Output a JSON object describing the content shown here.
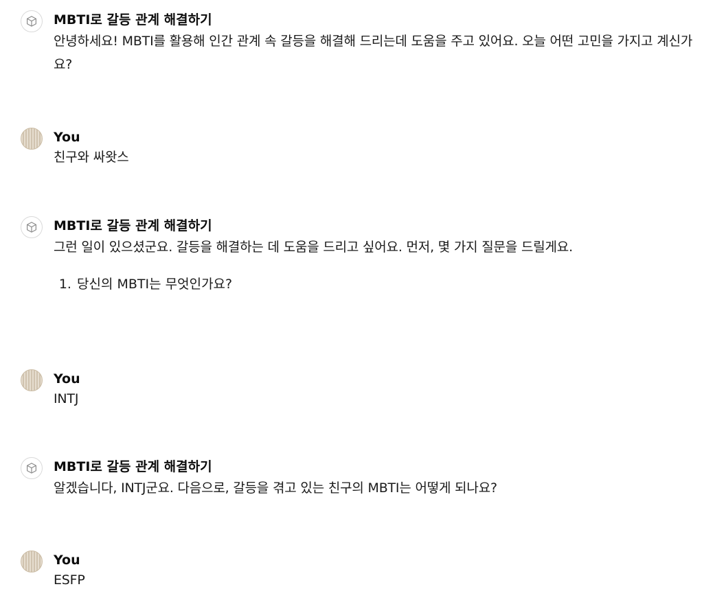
{
  "conversation": {
    "bot_name": "MBTI로 갈등 관계 해결하기",
    "user_name": "You",
    "m1": {
      "text": "안녕하세요! MBTI를 활용해 인간 관계 속 갈등을 해결해 드리는데 도움을 주고 있어요. 오늘 어떤 고민을 가지고 계신가요?"
    },
    "m2": {
      "text": "친구와 싸왓스"
    },
    "m3": {
      "text": "그런 일이 있으셨군요. 갈등을 해결하는 데 도움을 드리고 싶어요. 먼저, 몇 가지 질문을 드릴게요.",
      "list": [
        "당신의 MBTI는 무엇인가요?"
      ]
    },
    "m4": {
      "text": "INTJ"
    },
    "m5": {
      "text": "알겠습니다, INTJ군요. 다음으로, 갈등을 겪고 있는 친구의 MBTI는 어떻게 되나요?"
    },
    "m6": {
      "text": "ESFP"
    }
  }
}
